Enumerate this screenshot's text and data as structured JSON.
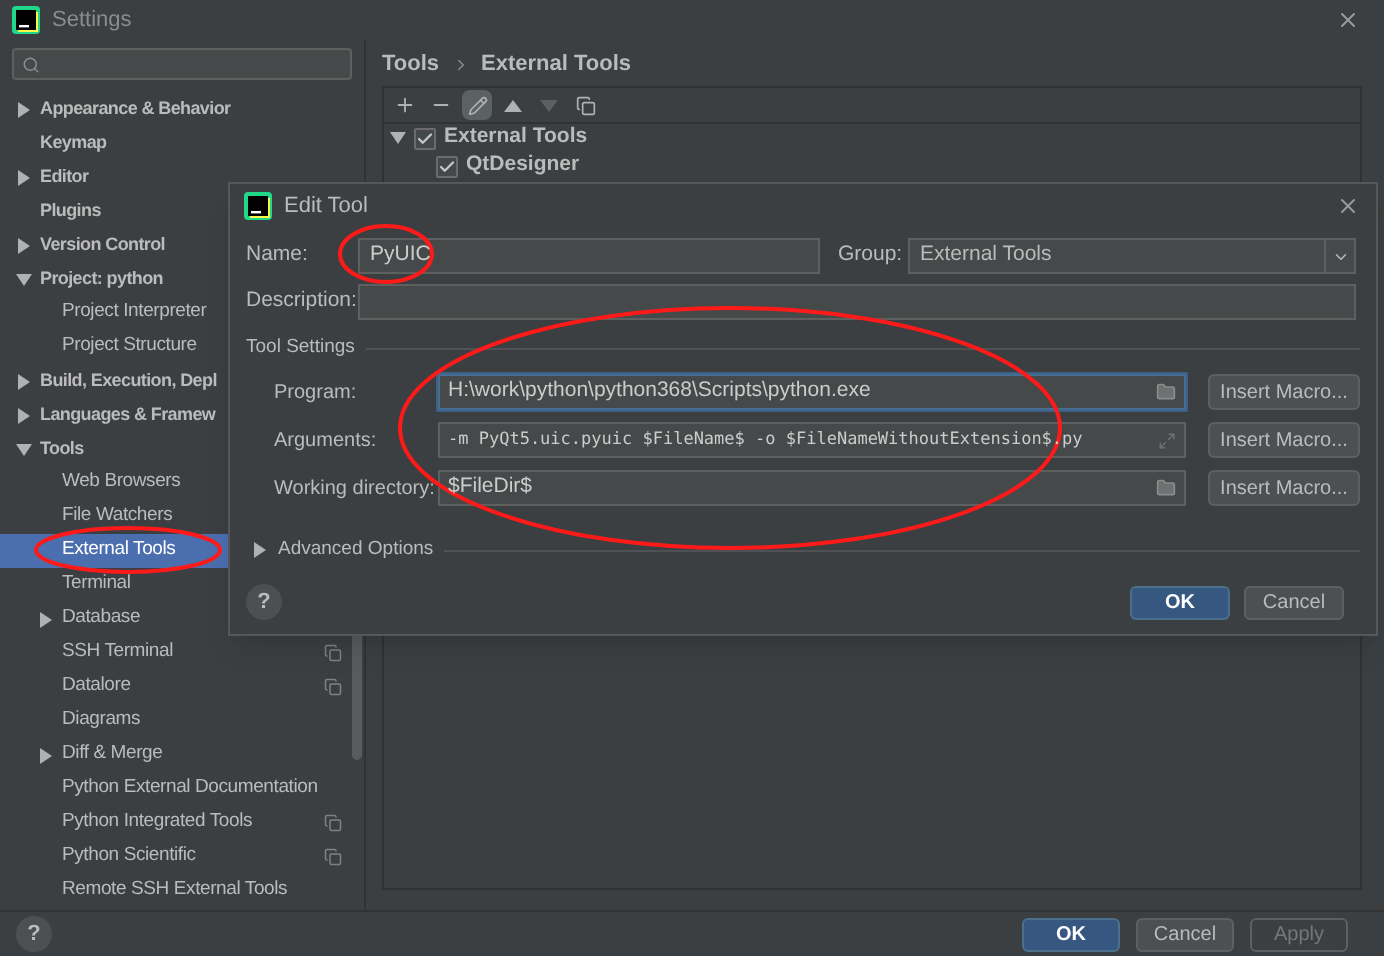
{
  "window": {
    "title": "Settings"
  },
  "sidebar": {
    "items": [
      {
        "label": "Appearance & Behavior",
        "selected": false,
        "scoped": false,
        "expanded": false
      },
      {
        "label": "Keymap",
        "selected": false,
        "scoped": false
      },
      {
        "label": "Editor",
        "selected": false,
        "scoped": false,
        "expanded": false
      },
      {
        "label": "Plugins",
        "selected": false,
        "scoped": false
      },
      {
        "label": "Version Control",
        "selected": false,
        "scoped": false,
        "expanded": false
      },
      {
        "label": "Project: python",
        "selected": false,
        "scoped": false,
        "expanded": true,
        "children": [
          {
            "label": "Project Interpreter",
            "selected": false,
            "scoped": false
          },
          {
            "label": "Project Structure",
            "selected": false,
            "scoped": false
          }
        ]
      },
      {
        "label": "Build, Execution, Depl",
        "selected": false,
        "scoped": false,
        "expanded": false
      },
      {
        "label": "Languages & Framew",
        "selected": false,
        "scoped": false,
        "expanded": false
      },
      {
        "label": "Tools",
        "selected": false,
        "scoped": false,
        "expanded": true,
        "children": [
          {
            "label": "Web Browsers",
            "selected": false,
            "scoped": false
          },
          {
            "label": "File Watchers",
            "selected": false,
            "scoped": false
          },
          {
            "label": "External Tools",
            "selected": true,
            "scoped": false
          },
          {
            "label": "Terminal",
            "selected": false,
            "scoped": false
          },
          {
            "label": "Database",
            "selected": false,
            "scoped": false,
            "expanded": false
          },
          {
            "label": "SSH Terminal",
            "selected": false,
            "scoped": true
          },
          {
            "label": "Datalore",
            "selected": false,
            "scoped": true
          },
          {
            "label": "Diagrams",
            "selected": false,
            "scoped": false
          },
          {
            "label": "Diff & Merge",
            "selected": false,
            "scoped": false,
            "expanded": false
          },
          {
            "label": "Python External Documentation",
            "selected": false,
            "scoped": false
          },
          {
            "label": "Python Integrated Tools",
            "selected": false,
            "scoped": true
          },
          {
            "label": "Python Scientific",
            "selected": false,
            "scoped": true
          },
          {
            "label": "Remote SSH External Tools",
            "selected": false,
            "scoped": false
          }
        ]
      }
    ]
  },
  "breadcrumb": [
    "Tools",
    "External Tools"
  ],
  "toolbar": [
    {
      "kind": "add",
      "selected": false,
      "disabled": false
    },
    {
      "kind": "remove",
      "selected": false,
      "disabled": false
    },
    {
      "kind": "edit",
      "selected": true,
      "disabled": false
    },
    {
      "kind": "up",
      "selected": false,
      "disabled": false
    },
    {
      "kind": "down",
      "selected": false,
      "disabled": true
    },
    {
      "kind": "copy",
      "selected": false,
      "disabled": false
    }
  ],
  "tool_tree": [
    {
      "label": "External Tools",
      "checked": true,
      "expanded": true,
      "children": [
        {
          "label": "QtDesigner",
          "checked": true
        }
      ]
    }
  ],
  "dialog": {
    "title": "Edit Tool",
    "name": {
      "label": "Name:",
      "value": "PyUIC"
    },
    "group": {
      "label": "Group:",
      "value": "External Tools"
    },
    "description": {
      "label": "Description:"
    },
    "section": "Tool Settings",
    "fields": [
      {
        "label": "Program:",
        "value": "H:\\work\\python\\python368\\Scripts\\python.exe",
        "kind": "browse",
        "focused": true,
        "button": "Insert Macro..."
      },
      {
        "label": "Arguments:",
        "value": "-m PyQt5.uic.pyuic $FileName$ -o $FileNameWithoutExtension$.py",
        "kind": "expand",
        "focused": false,
        "button": "Insert Macro..."
      },
      {
        "label": "Working directory:",
        "value": "$FileDir$",
        "kind": "browse",
        "focused": false,
        "button": "Insert Macro..."
      }
    ],
    "advanced": {
      "label": "Advanced Options",
      "expanded": false
    },
    "help": "?",
    "buttons": [
      {
        "label": "OK",
        "primary": true
      },
      {
        "label": "Cancel",
        "primary": false
      }
    ]
  },
  "help": "?",
  "footer_buttons": [
    {
      "label": "OK",
      "primary": true,
      "disabled": false
    },
    {
      "label": "Cancel",
      "primary": false,
      "disabled": false
    },
    {
      "label": "Apply",
      "primary": false,
      "disabled": true
    }
  ]
}
